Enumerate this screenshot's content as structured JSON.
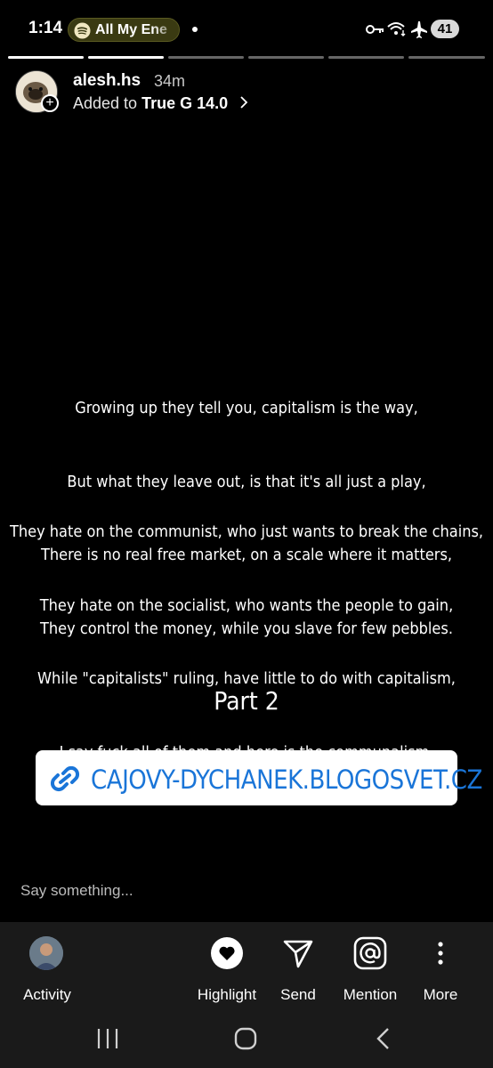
{
  "status_bar": {
    "time": "1:14",
    "media_pill": "All My Ene",
    "battery": "41"
  },
  "story": {
    "username": "alesh.hs",
    "posted_ago": "34m",
    "added_prefix": "Added to",
    "added_to": "True G 14.0",
    "segments_total": 6,
    "segments_viewed": 2,
    "stanza1": [
      "Growing up they tell you, capitalism is the way,",
      "But what they leave out, is that it's all just a play,",
      "There is no real free market, on a scale where it matters,",
      "They control the money, while you slave for few pebbles."
    ],
    "stanza2": [
      "They hate on the communist, who just wants to break the chains,",
      "They hate on the socialist, who wants the people to gain,",
      "While \"capitalists\" ruling, have little to do with capitalism,",
      "I say fuck all of them and here is the communalism."
    ],
    "part_label": "Part 2",
    "link_text": "CAJOVY-DYCHANEK.BLOGOSVET.CZ"
  },
  "reply": {
    "placeholder": "Say something..."
  },
  "actions": {
    "activity": "Activity",
    "highlight": "Highlight",
    "send": "Send",
    "mention": "Mention",
    "more": "More"
  },
  "colors": {
    "link": "#1a75d8",
    "bar_bg": "#1a1a1a"
  }
}
